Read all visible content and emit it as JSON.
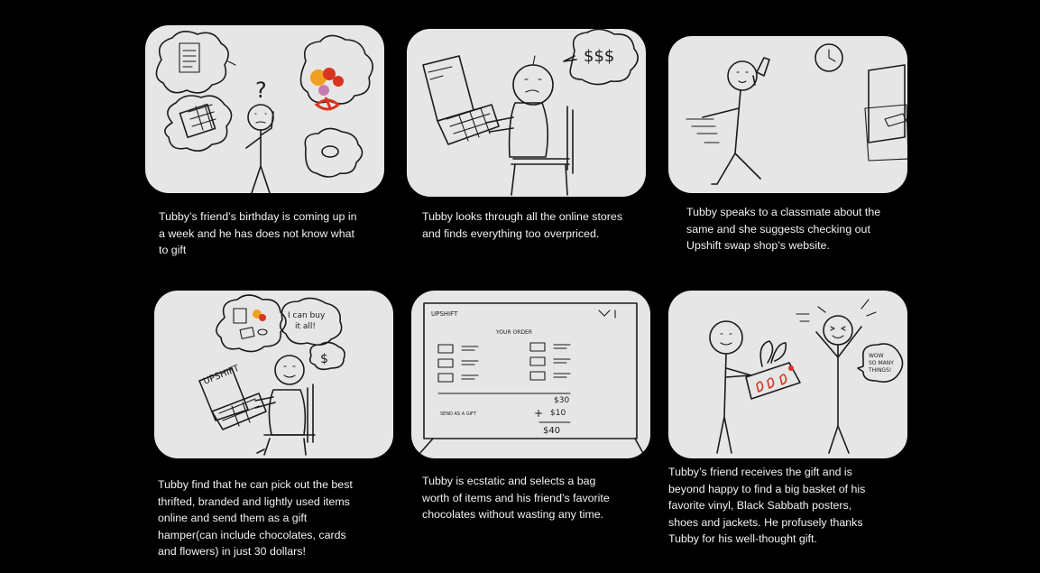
{
  "storyboard": {
    "panels": [
      {
        "caption": "Tubby’s friend’s birthday is coming up in\na week and he has does not know what\nto gift",
        "sketch_text": [
          "?"
        ]
      },
      {
        "caption": "Tubby looks through all the online stores\nand finds everything too overpriced.",
        "sketch_text": [
          "$$$"
        ]
      },
      {
        "caption": "Tubby speaks to a classmate about the\nsame and  she suggests checking out\nUpshift swap shop’s website.",
        "sketch_text": []
      },
      {
        "caption": "Tubby find that he can pick out the best\nthrifted, branded and lightly used items\nonline and send them as a gift\nhamper(can include chocolates, cards\nand flowers)  in just 30 dollars!",
        "sketch_text": [
          "UPSHIFT",
          "I can buy\nit all!",
          "$"
        ]
      },
      {
        "caption": "Tubby is ecstatic and selects a bag\nworth of items and his friend’s favorite\nchocolates without wasting any time.",
        "sketch_text": [
          "UPSHIFT",
          "YOUR ORDER",
          "$30",
          "SEND AS A GIFT",
          "+",
          "$10",
          "$40"
        ]
      },
      {
        "caption": "Tubby’s friend receives the gift and is\nbeyond happy to find a big basket of his\nfavorite vinyl, Black Sabbath posters,\nshoes and jackets. He profusely thanks\nTubby for his well-thought gift.",
        "sketch_text": [
          "WOW\nSO MANY\nTHINGS!"
        ]
      }
    ]
  },
  "colors": {
    "background": "#000000",
    "panel": "#e6e6e6",
    "caption": "#f2f2f2",
    "ink": "#1b1b1b",
    "accent_red": "#d8341f",
    "accent_orange": "#f0a020"
  }
}
